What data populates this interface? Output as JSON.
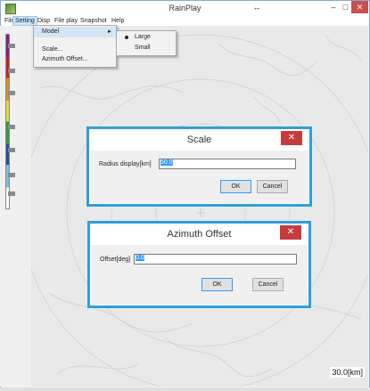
{
  "window": {
    "title": "RainPlay",
    "restore_glyph": "↔",
    "minimize_glyph": "–",
    "maximize_glyph": "□",
    "close_glyph": "✕",
    "app_icon": "app-icon"
  },
  "menu": {
    "items": [
      "File",
      "Setting",
      "Disp",
      "File play",
      "Snapshot",
      "Help"
    ],
    "active": "Setting"
  },
  "setting_menu": {
    "items": [
      "Model",
      "Scale...",
      "Azimuth Offset..."
    ],
    "submenu_arrow": "►",
    "model_submenu": {
      "items": [
        "Large",
        "Small"
      ],
      "selected": "Large"
    }
  },
  "map": {
    "scale_readout": "30.0[km]",
    "range_rings": 4
  },
  "legend": {
    "colors": [
      "#8a1a8c",
      "#d01d1d",
      "#e08a2a",
      "#e4dd2a",
      "#2a9e3a",
      "#1e4fb0",
      "#6bc6e6",
      "#ffffff"
    ]
  },
  "scale_dialog": {
    "title": "Scale",
    "label": "Radius display[km]",
    "value": "50.0",
    "ok": "OK",
    "cancel": "Cancel",
    "close_glyph": "✕"
  },
  "azimuth_dialog": {
    "title": "Azimuth Offset",
    "label": "Offset[deg]",
    "value": "0.0",
    "ok": "OK",
    "cancel": "Cancel",
    "close_glyph": "✕"
  }
}
